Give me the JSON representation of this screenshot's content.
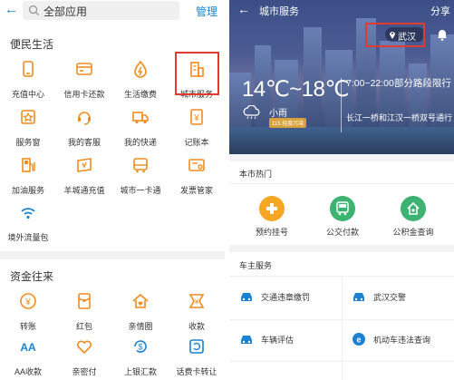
{
  "left": {
    "search_placeholder": "全部应用",
    "manage": "管理",
    "sections": [
      {
        "title": "便民生活",
        "items": [
          {
            "label": "充值中心",
            "icon": "phone-recharge-icon"
          },
          {
            "label": "信用卡还款",
            "icon": "credit-card-icon"
          },
          {
            "label": "生活缴费",
            "icon": "utility-bill-icon"
          },
          {
            "label": "城市服务",
            "icon": "city-building-icon"
          },
          {
            "label": "服务窗",
            "icon": "service-window-icon"
          },
          {
            "label": "我的客服",
            "icon": "customer-service-icon"
          },
          {
            "label": "我的快递",
            "icon": "delivery-truck-icon"
          },
          {
            "label": "记账本",
            "icon": "ledger-icon"
          },
          {
            "label": "加油服务",
            "icon": "gas-station-icon"
          },
          {
            "label": "羊城通充值",
            "icon": "transit-card-icon"
          },
          {
            "label": "城市一卡通",
            "icon": "bus-card-icon"
          },
          {
            "label": "发票管家",
            "icon": "invoice-icon"
          },
          {
            "label": "境外流量包",
            "icon": "wifi-icon"
          }
        ]
      },
      {
        "title": "资金往来",
        "items": [
          {
            "label": "转账",
            "icon": "transfer-icon"
          },
          {
            "label": "红包",
            "icon": "red-packet-icon"
          },
          {
            "label": "亲情圈",
            "icon": "family-home-icon"
          },
          {
            "label": "收款",
            "icon": "collect-money-icon"
          },
          {
            "label": "AA收款",
            "icon": "aa-collect-icon"
          },
          {
            "label": "亲密付",
            "icon": "heart-pay-icon"
          },
          {
            "label": "上银汇款",
            "icon": "bank-remit-icon"
          },
          {
            "label": "话费卡转让",
            "icon": "card-transfer-icon"
          }
        ]
      }
    ]
  },
  "right": {
    "title": "城市服务",
    "share": "分享",
    "location": "武汉",
    "temperature": "14℃~18℃",
    "weather": "小雨",
    "aqi": "115 轻度污染",
    "limit_line1": "7:00~22:00部分路段限行",
    "limit_line2": "长江一桥和江汉一桥双号通行",
    "hot_title": "本市热门",
    "hot_items": [
      {
        "label": "预约挂号",
        "icon": "hospital-cross-icon",
        "color": "#f5a623"
      },
      {
        "label": "公交付款",
        "icon": "bus-pay-icon",
        "color": "#3cb371"
      },
      {
        "label": "公积金查询",
        "icon": "fund-query-icon",
        "color": "#3cb371"
      }
    ],
    "car_title": "车主服务",
    "car_items": [
      {
        "label": "交通违章缴罚",
        "icon": "car-icon"
      },
      {
        "label": "武汉交警",
        "icon": "car-icon"
      },
      {
        "label": "车辆评估",
        "icon": "car-icon"
      },
      {
        "label": "机动车违法查询",
        "icon": "traffic-police-icon"
      }
    ]
  },
  "colors": {
    "accent": "#1b82d2",
    "icon_orange": "#f08c1e",
    "highlight": "#e23a2e"
  }
}
